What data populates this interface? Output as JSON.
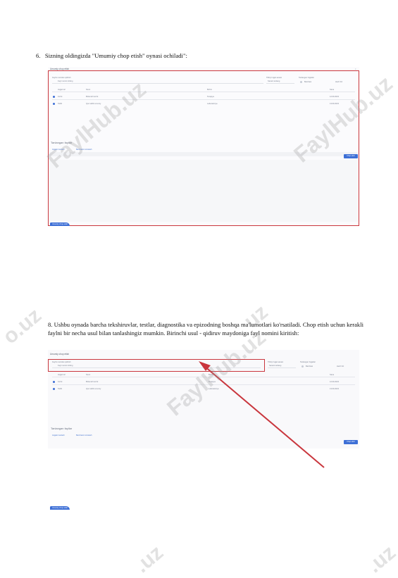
{
  "steps": {
    "step6": "6.   Sizning oldingizda \"Umumiy chop etish\" oynasi ochiladi\":",
    "step8": "8. Ushbu oynada barcha tekshiruvlar, testlar, diagnostika va epizodning boshqa ma'lumotlari ko'rsatiladi. Chop etish uchun kerakli faylni bir necha usul bilan tanlashingiz mumkin. Birinchi usul - qidiruv maydoniga fayl nomini kiritish:"
  },
  "screenshot1": {
    "dialog_title": "Umumiy chop etish",
    "search_label": "Faylni nomidan qidirish",
    "search_placeholder": "Fayl nomini kiriting",
    "date_label": "Tibbiy hujjat sanasi",
    "date_value": "Sanani tanlang",
    "filter_label": "Tanlangan hujjatlar",
    "filter_opt1": "Barchasi",
    "filter_opt2": "Hech biri",
    "columns": [
      "Hujjat turi",
      "Nomi",
      "Bo'lim",
      "Sana"
    ],
    "rows": [
      {
        "type": "Ko'rik",
        "name": "Birlamchi ko'rik",
        "dept": "Terapiya",
        "date": "12.09.2023"
      },
      {
        "type": "Tahlil",
        "name": "Qon tahlili umumiy",
        "dept": "Laboratoriya",
        "date": "13.09.2023"
      }
    ],
    "selected_heading": "Tanlangan fayllar",
    "selected_link1": "Hujjatni tanlash",
    "selected_link2": "Barchasini tozalash",
    "print_button": "Chop etish",
    "tab_label": "Umumiy chop etish"
  },
  "screenshot2": {
    "dialog_title": "Umumiy chop etish",
    "search_label": "Faylni nomidan qidirish",
    "search_placeholder": "Fayl nomini kiriting",
    "date_label": "Tibbiy hujjat sanasi",
    "date_value": "Sanani tanlang",
    "filter_label": "Tanlangan hujjatlar",
    "filter_opt1": "Barchasi",
    "filter_opt2": "Hech biri",
    "columns": [
      "Hujjat turi",
      "Nomi",
      "Bo'lim",
      "Sana"
    ],
    "rows": [
      {
        "type": "Ko'rik",
        "name": "Birlamchi ko'rik",
        "dept": "Terapiya",
        "date": "12.09.2023"
      },
      {
        "type": "Tahlil",
        "name": "Qon tahlili umumiy",
        "dept": "Laboratoriya",
        "date": "13.09.2023"
      }
    ],
    "selected_heading": "Tanlangan fayllar",
    "selected_link1": "Hujjatni tanlash",
    "selected_link2": "Barchasini tozalash",
    "print_button": "Chop etish",
    "tab_label": "Umumiy chop etish"
  },
  "watermark": {
    "text_full": "FaylHub.uz",
    "text_part1": ".uz",
    "text_part2": "o.uz",
    "text_part3": "uz",
    "color": "#969696"
  },
  "colors": {
    "highlight": "#c9363d",
    "accent": "#3d6fd6"
  }
}
